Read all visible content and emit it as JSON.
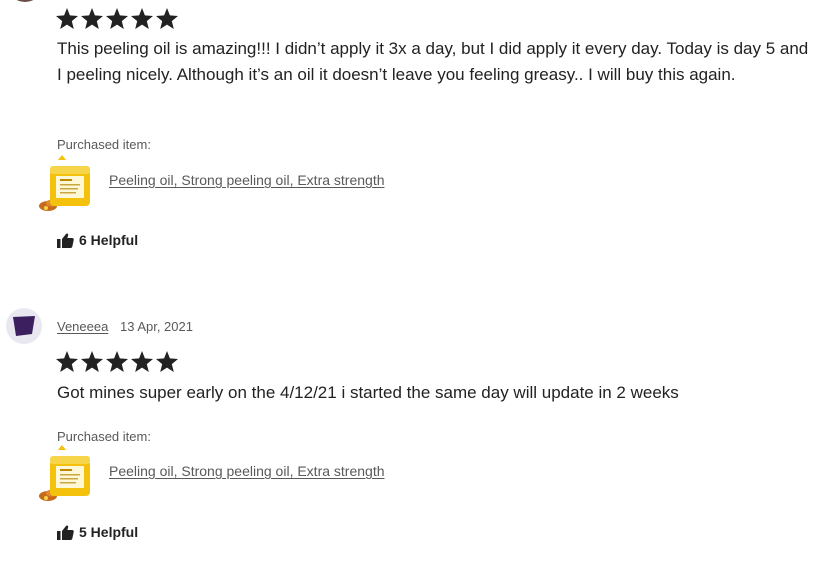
{
  "reviews": [
    {
      "rating": 5,
      "rating_max": 5,
      "text": "This peeling oil is amazing!!! I didn’t apply it 3x a day, but I did apply it every day. Today is day 5 and I peeling nicely. Although it’s an oil it doesn’t leave you feeling greasy.. I will buy this again.",
      "purchased_label": "Purchased item:",
      "product_name": "Peeling oil, Strong peeling oil, Extra strength",
      "helpful_label": "6 Helpful",
      "icons": {
        "helpful": "thumbs-up-icon",
        "product": "product-thumbnail"
      }
    },
    {
      "reviewer": "Veneeea",
      "date": "13 Apr, 2021",
      "rating": 5,
      "rating_max": 5,
      "text": "Got mines super early on the 4/12/21 i started the same day will update in 2 weeks",
      "purchased_label": "Purchased item:",
      "product_name": "Peeling oil, Strong peeling oil, Extra strength",
      "helpful_label": "5 Helpful",
      "icons": {
        "avatar": "purple-shape-avatar",
        "helpful": "thumbs-up-icon",
        "product": "product-thumbnail"
      }
    }
  ],
  "colors": {
    "star": "#222222",
    "text": "#222222",
    "muted": "#595959",
    "avatar_bg": "#e9e7ef",
    "avatar_shape": "#3b1f5e",
    "product_yellow": "#f4c20d"
  }
}
